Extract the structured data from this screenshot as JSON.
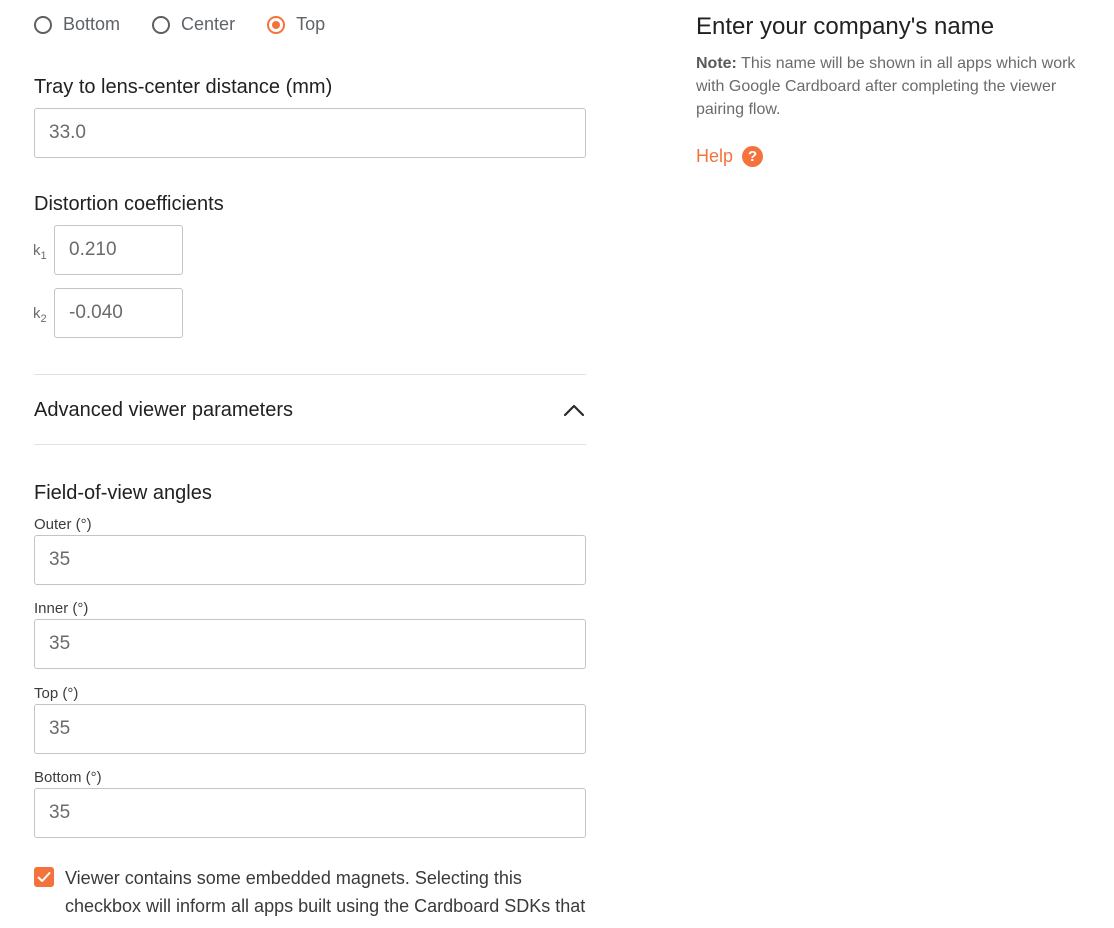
{
  "alignment": {
    "options": [
      {
        "label": "Bottom",
        "checked": false
      },
      {
        "label": "Center",
        "checked": false
      },
      {
        "label": "Top",
        "checked": true
      }
    ]
  },
  "tray": {
    "label": "Tray to lens-center distance (mm)",
    "value": "33.0"
  },
  "distortion": {
    "label": "Distortion coefficients",
    "k1_label": "k",
    "k1_sub": "1",
    "k1_value": "0.210",
    "k2_label": "k",
    "k2_sub": "2",
    "k2_value": "-0.040"
  },
  "advanced": {
    "label": "Advanced viewer parameters",
    "icon": "chevron-up-icon",
    "expanded": true
  },
  "fov": {
    "label": "Field-of-view angles",
    "outer_label": "Outer (°)",
    "outer_value": "35",
    "inner_label": "Inner (°)",
    "inner_value": "35",
    "top_label": "Top (°)",
    "top_value": "35",
    "bottom_label": "Bottom (°)",
    "bottom_value": "35"
  },
  "magnets": {
    "checked": true,
    "text": "Viewer contains some embedded magnets. Selecting this checkbox will inform all apps built using the Cardboard SDKs that"
  },
  "company": {
    "title": "Enter your company's name",
    "note_bold": "Note:",
    "note_text": " This name will be shown in all apps which work with Google Cardboard after completing the viewer pairing flow.",
    "help_label": "Help",
    "help_icon_glyph": "?"
  },
  "colors": {
    "accent": "#f4733c",
    "text": "#212121",
    "muted": "#6b6b6b",
    "border": "#c4c4c4"
  }
}
